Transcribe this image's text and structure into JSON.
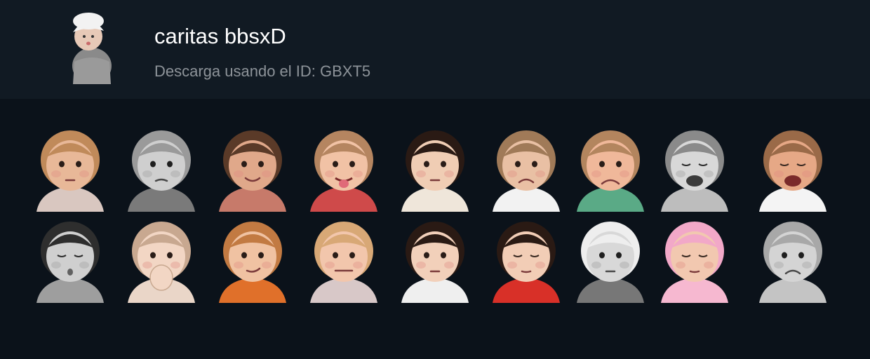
{
  "pack": {
    "title": "caritas bbsxD",
    "subtitle": "Descarga usando el ID: GBXT5",
    "thumbnail_icon": "baby-in-white-beanie-sticker"
  },
  "stickers": [
    {
      "name": "baby-with-drink-sticker",
      "tone": "color",
      "skin": "#e8b898",
      "hair": "#c08a5a",
      "shirt": "#d9c7c0",
      "expression": "neutral"
    },
    {
      "name": "pouting-baby-pigtails-sticker",
      "tone": "gray",
      "skin": "#cfcfcf",
      "hair": "#9a9a9a",
      "shirt": "#7a7a7a",
      "expression": "pout"
    },
    {
      "name": "curly-hair-girl-sticker",
      "tone": "color",
      "skin": "#e0a88a",
      "hair": "#5a3a28",
      "shirt": "#c77a6a",
      "expression": "smile"
    },
    {
      "name": "baby-tongue-out-sticker",
      "tone": "color",
      "skin": "#f1c2a5",
      "hair": "#b58560",
      "shirt": "#cf4a4a",
      "expression": "tongue"
    },
    {
      "name": "girl-drinking-with-phone-sticker",
      "tone": "color",
      "skin": "#f0cdb4",
      "hair": "#2a1a14",
      "shirt": "#efe6da",
      "expression": "neutral"
    },
    {
      "name": "frowning-baby-sticker",
      "tone": "color",
      "skin": "#e9c0a4",
      "hair": "#a07a58",
      "shirt": "#f2f2f2",
      "expression": "frown"
    },
    {
      "name": "sad-chubby-baby-sticker",
      "tone": "color",
      "skin": "#f0b89a",
      "hair": "#b3855e",
      "shirt": "#5aaa86",
      "expression": "sad"
    },
    {
      "name": "crying-baby-gray-sticker",
      "tone": "gray",
      "skin": "#d8d8d8",
      "hair": "#8a8a8a",
      "shirt": "#bdbdbd",
      "expression": "cry"
    },
    {
      "name": "wailing-baby-sticker",
      "tone": "color",
      "skin": "#e6a886",
      "hair": "#9a6a48",
      "shirt": "#f4f4f4",
      "expression": "cry"
    },
    {
      "name": "afro-baby-sticker",
      "tone": "gray",
      "skin": "#cfcfcf",
      "hair": "#2e2e2e",
      "shirt": "#9e9e9e",
      "expression": "blow"
    },
    {
      "name": "baby-covering-mouth-sticker",
      "tone": "color",
      "skin": "#f2d6c4",
      "hair": "#c8a890",
      "shirt": "#ead6c8",
      "expression": "hand"
    },
    {
      "name": "redhead-toddler-sticker",
      "tone": "color",
      "skin": "#f0c2a2",
      "hair": "#c27a42",
      "shirt": "#e0702a",
      "expression": "smirk"
    },
    {
      "name": "blonde-toddler-sticker",
      "tone": "color",
      "skin": "#f2c6ac",
      "hair": "#d8a876",
      "shirt": "#d8c8c8",
      "expression": "grimace"
    },
    {
      "name": "girl-with-juice-box-sticker",
      "tone": "color",
      "skin": "#f2d0ba",
      "hair": "#2a1a14",
      "shirt": "#efefef",
      "expression": "neutral"
    },
    {
      "name": "sleeping-girl-sticker",
      "tone": "color",
      "skin": "#f2cdb6",
      "hair": "#2a1a14",
      "shirt": "#d83028",
      "expression": "sleep"
    },
    {
      "name": "baby-in-beanie-sticker",
      "tone": "gray",
      "skin": "#d8d8d8",
      "hair": "#eeeeee",
      "shirt": "#777777",
      "expression": "neutral"
    },
    {
      "name": "spa-baby-sticker",
      "tone": "color",
      "skin": "#f2c8b0",
      "hair": "#f2a8c8",
      "shirt": "#f6b8d0",
      "expression": "sleep"
    },
    {
      "name": "grumpy-curly-toddler-sticker",
      "tone": "gray",
      "skin": "#d4d4d4",
      "hair": "#a8a8a8",
      "shirt": "#c4c4c4",
      "expression": "frown"
    }
  ]
}
